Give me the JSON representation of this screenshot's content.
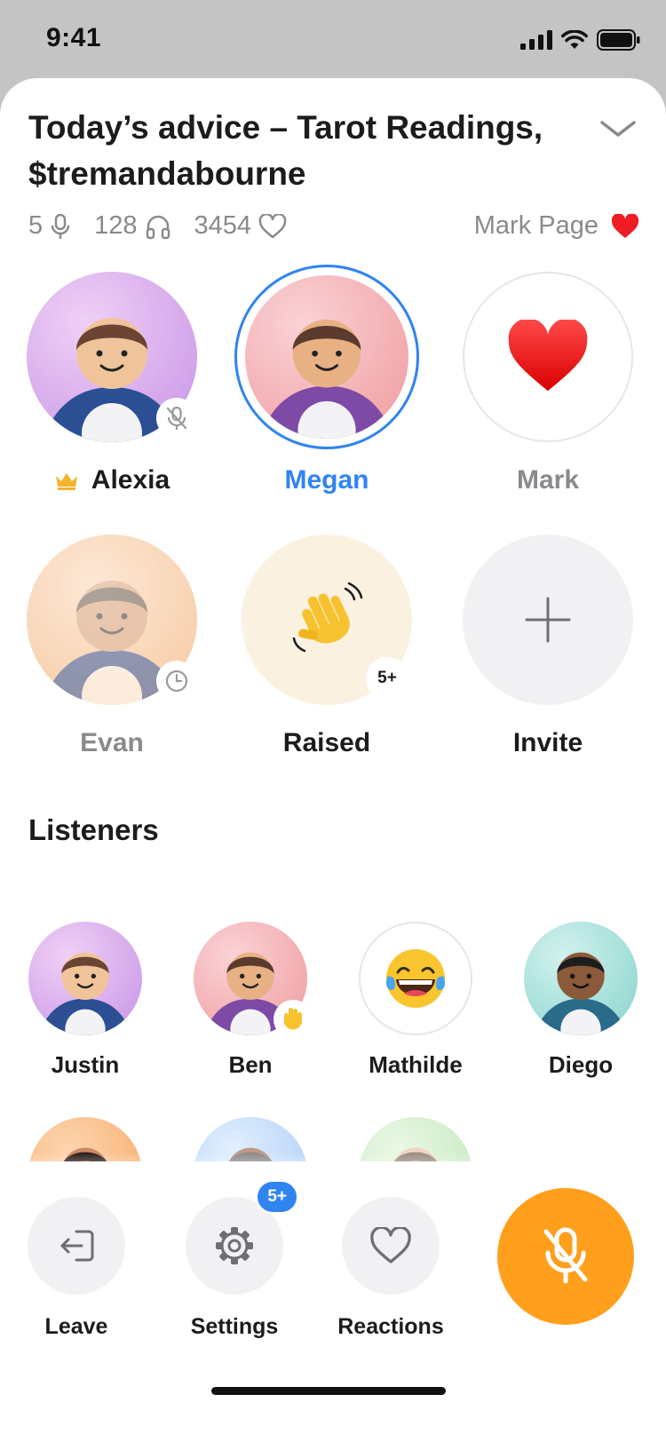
{
  "status": {
    "time": "9:41"
  },
  "room": {
    "title": "Today’s advice – Tarot Readings,  $tremandabourne",
    "stats": {
      "speakers": "5",
      "listeners": "128",
      "likes": "3454"
    },
    "mark_page_label": "Mark Page"
  },
  "speakers": [
    {
      "name": "Alexia",
      "badge": "mic-off-icon",
      "host": true
    },
    {
      "name": "Megan",
      "active": true
    },
    {
      "name": "Mark",
      "avatar": "heart-icon"
    },
    {
      "name": "Evan",
      "badge": "clock-icon"
    },
    {
      "name": "Raised",
      "count": "5+"
    },
    {
      "name": "Invite"
    }
  ],
  "listeners_title": "Listeners",
  "listeners": [
    {
      "name": "Justin"
    },
    {
      "name": "Ben",
      "badge": "raised-hand-icon"
    },
    {
      "name": "Mathilde",
      "avatar": "laughing-emoji-icon"
    },
    {
      "name": "Diego"
    }
  ],
  "controls": {
    "leave": "Leave",
    "settings": "Settings",
    "settings_badge": "5+",
    "reactions": "Reactions"
  },
  "colors": {
    "accent_blue": "#2f84f2",
    "mic_orange": "#ff9f1c",
    "heart_red": "#ee1d25",
    "crown_gold": "#f5b22b"
  }
}
